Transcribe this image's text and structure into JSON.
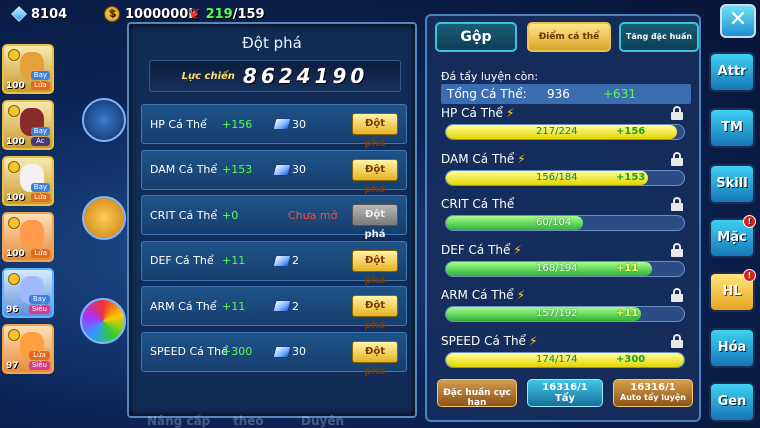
{
  "resources": {
    "gems": "8104",
    "coins": "1000000k",
    "stamina_current": "219",
    "stamina_max": "/159"
  },
  "roster": [
    {
      "level": "100",
      "tags": [
        "Bay",
        "Lửa"
      ],
      "style": "gold"
    },
    {
      "level": "100",
      "tags": [
        "Bay",
        "Ác"
      ],
      "style": "gold"
    },
    {
      "level": "100",
      "tags": [
        "Bay",
        "Lửa"
      ],
      "style": "gold"
    },
    {
      "level": "100",
      "tags": [
        "Lửa"
      ],
      "style": "orange"
    },
    {
      "level": "96",
      "tags": [
        "Bay",
        "Siêu"
      ],
      "style": "blue"
    },
    {
      "level": "97",
      "tags": [
        "Lửa",
        "Siêu"
      ],
      "style": "orange"
    }
  ],
  "left_panel": {
    "title": "Đột phá",
    "power_label": "Lực chiến",
    "power_value": "8624190",
    "rows": [
      {
        "name": "HP Cá Thể",
        "bonus": "+156",
        "cost": "30",
        "button": "Đột phá",
        "locked": false
      },
      {
        "name": "DAM Cá Thể",
        "bonus": "+153",
        "cost": "30",
        "button": "Đột phá",
        "locked": false
      },
      {
        "name": "CRIT Cá Thể",
        "bonus": "+0",
        "cost": "",
        "status": "Chưa mở",
        "button": "Đột phá",
        "locked": true
      },
      {
        "name": "DEF Cá Thể",
        "bonus": "+11",
        "cost": "2",
        "button": "Đột phá",
        "locked": false
      },
      {
        "name": "ARM Cá Thể",
        "bonus": "+11",
        "cost": "2",
        "button": "Đột phá",
        "locked": false
      },
      {
        "name": "SPEED Cá Thể",
        "bonus": "+300",
        "cost": "30",
        "button": "Đột phá",
        "locked": false
      }
    ],
    "ghost_labels": [
      "Nâng cấp",
      "theo",
      "Duyên"
    ]
  },
  "right_panel": {
    "tabs": {
      "merge": "Gộp",
      "points": "Điểm cá thể",
      "special": "Tăng đặc huấn"
    },
    "remaining_label": "Đá tẩy luyện còn:",
    "total_label": "Tổng Cá Thể:",
    "total_value": "936",
    "total_bonus": "+631",
    "stats": [
      {
        "name": "HP Cá Thể",
        "bolt": true,
        "value": "217/224",
        "bonus": "+156",
        "fill": 0.969,
        "color": "yellow"
      },
      {
        "name": "DAM Cá Thể",
        "bolt": true,
        "value": "156/184",
        "bonus": "+153",
        "fill": 0.848,
        "color": "yellow"
      },
      {
        "name": "CRIT Cá Thể",
        "bolt": false,
        "value": "60/104",
        "bonus": "",
        "fill": 0.577,
        "color": "green"
      },
      {
        "name": "DEF Cá Thể",
        "bolt": true,
        "value": "168/194",
        "bonus": "+11",
        "fill": 0.866,
        "color": "green"
      },
      {
        "name": "ARM Cá Thể",
        "bolt": true,
        "value": "157/192",
        "bonus": "+11",
        "fill": 0.818,
        "color": "green"
      },
      {
        "name": "SPEED Cá Thể",
        "bolt": true,
        "value": "174/174",
        "bonus": "+300",
        "fill": 1.0,
        "color": "yellow"
      }
    ],
    "buttons": {
      "special_train": "Đặc huấn cực hạn",
      "wash_count": "16316/1",
      "wash_label": "Tẩy",
      "auto_count": "16316/1",
      "auto_label": "Auto tẩy luyện"
    }
  },
  "side_menu": [
    {
      "label": "Attr",
      "badge": false
    },
    {
      "label": "TM",
      "badge": false
    },
    {
      "label": "Skill",
      "badge": false
    },
    {
      "label": "Mặc",
      "badge": true
    },
    {
      "label": "HL",
      "badge": true,
      "active": true
    },
    {
      "label": "Hóa",
      "badge": false
    },
    {
      "label": "Gen",
      "badge": false
    }
  ],
  "close_symbol": "✕",
  "colors": {
    "accent_gold": "#e8c54a",
    "bonus_green": "#58ff4a",
    "locked_red": "#ff4a4a"
  }
}
